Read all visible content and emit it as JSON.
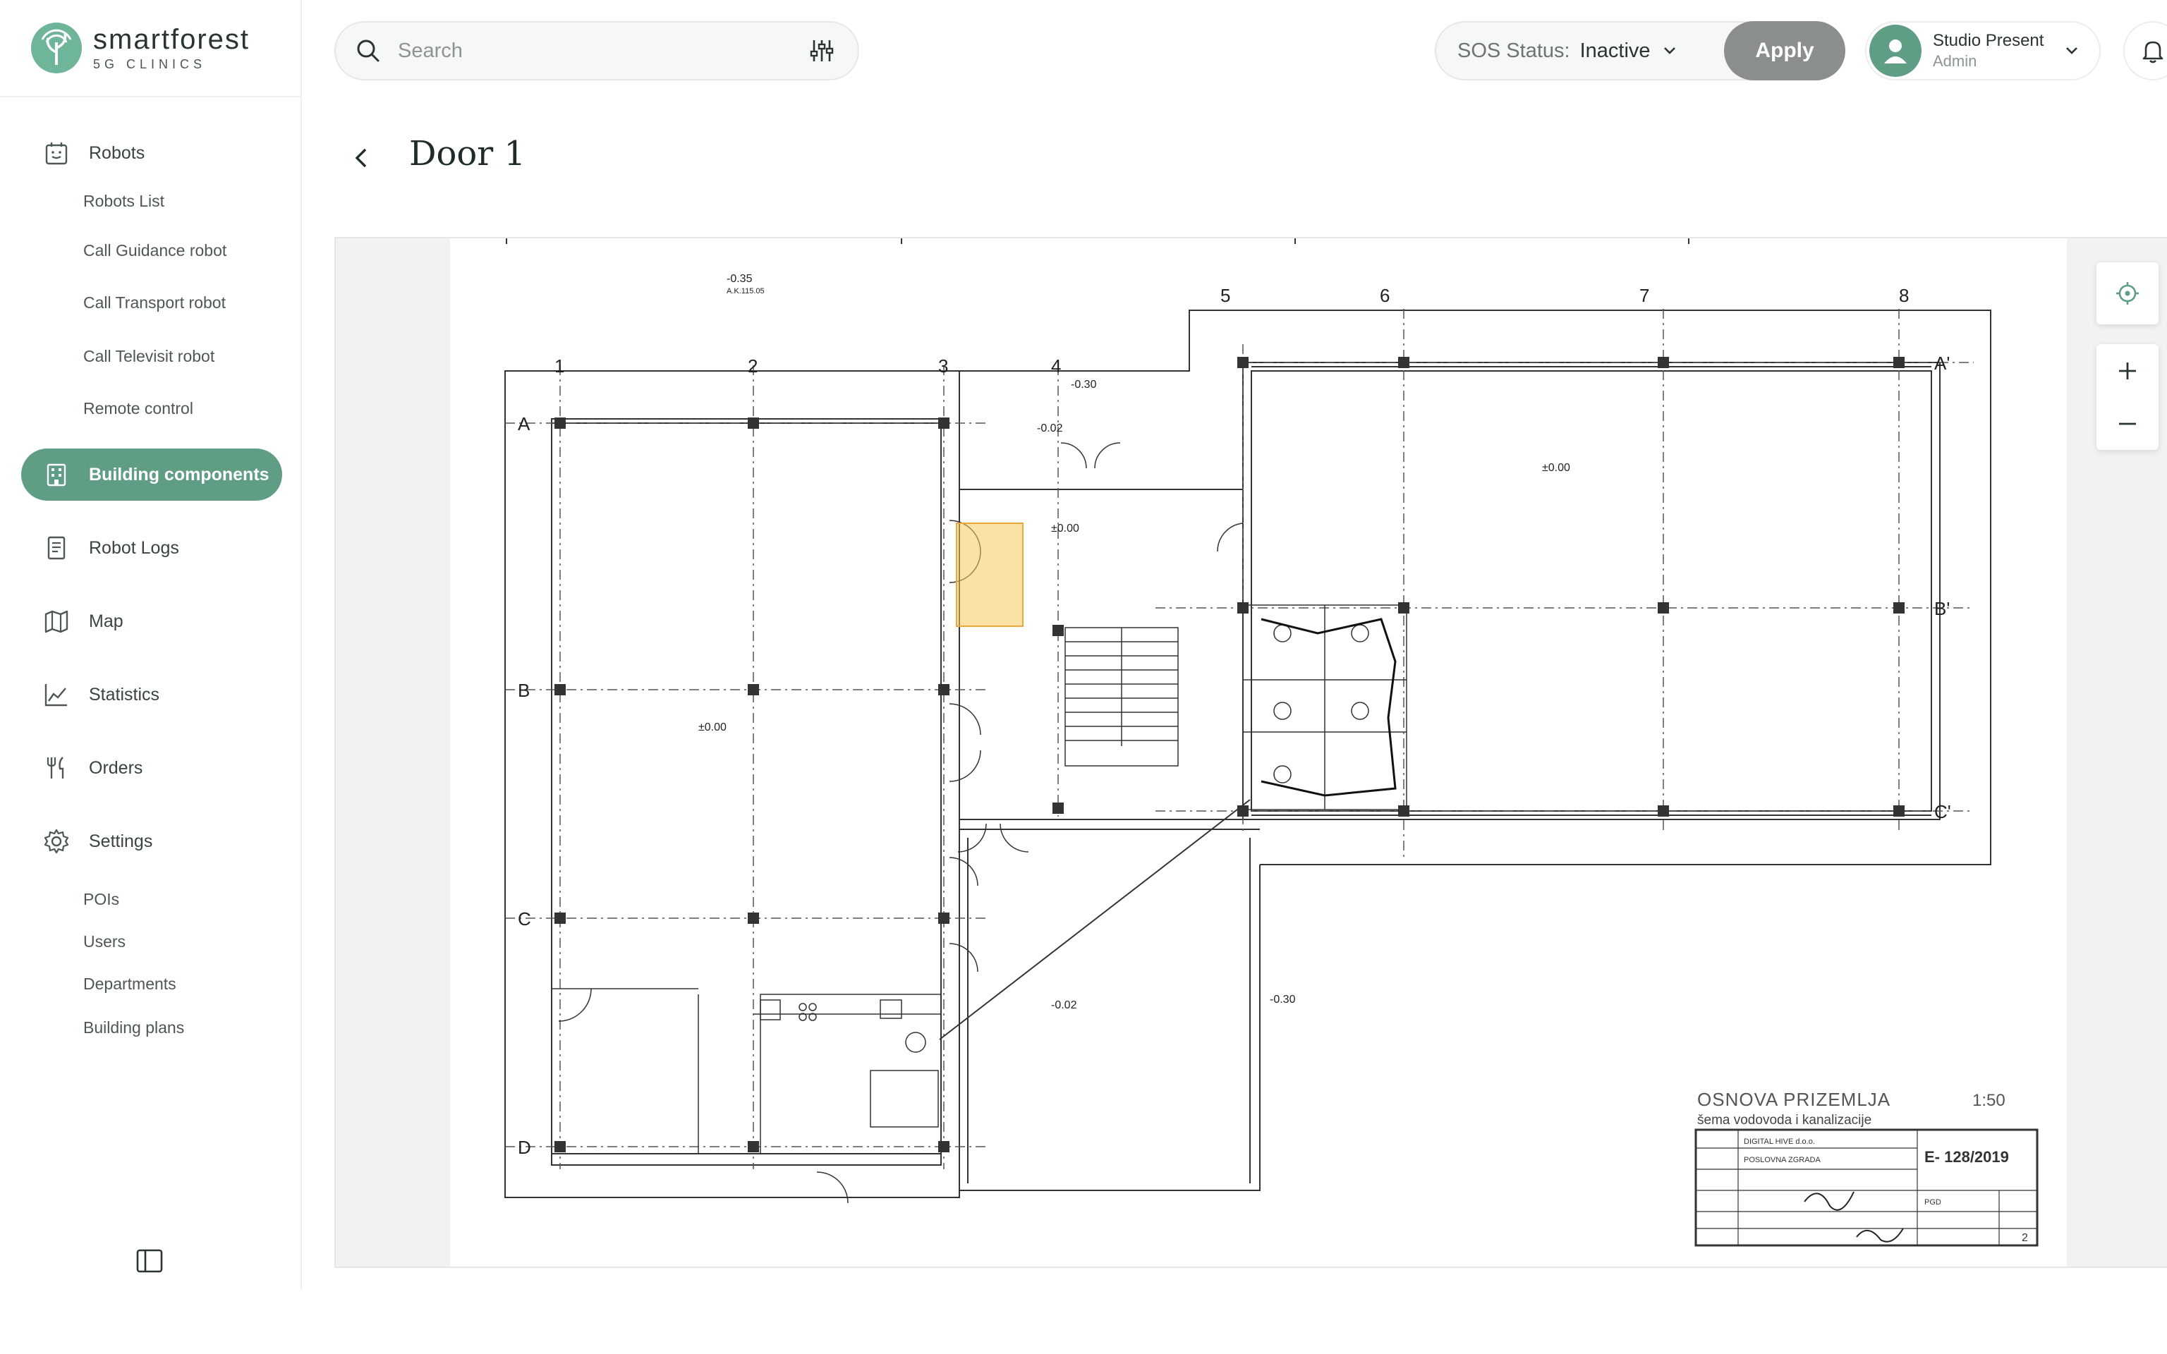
{
  "brand": {
    "name": "smartforest",
    "sub": "5G CLINICS"
  },
  "sidebar": {
    "robots": {
      "label": "Robots",
      "icon": "robot-icon",
      "items": [
        {
          "label": "Robots List"
        },
        {
          "label": "Call Guidance robot"
        },
        {
          "label": "Call Transport robot"
        },
        {
          "label": "Call Televisit robot"
        },
        {
          "label": "Remote control"
        }
      ]
    },
    "building": {
      "label": "Building components",
      "icon": "building-icon",
      "active": true
    },
    "logs": {
      "label": "Robot Logs",
      "icon": "document-icon"
    },
    "map": {
      "label": "Map",
      "icon": "map-icon"
    },
    "statistics": {
      "label": "Statistics",
      "icon": "chart-icon"
    },
    "orders": {
      "label": "Orders",
      "icon": "cutlery-icon"
    },
    "settings": {
      "label": "Settings",
      "icon": "gear-icon",
      "items": [
        {
          "label": "POIs"
        },
        {
          "label": "Users"
        },
        {
          "label": "Departments"
        },
        {
          "label": "Building plans"
        }
      ]
    }
  },
  "topbar": {
    "search": {
      "placeholder": "Search"
    },
    "sos": {
      "label": "SOS Status:",
      "value": "Inactive",
      "apply_label": "Apply"
    },
    "user": {
      "name": "Studio Present",
      "role": "Admin"
    }
  },
  "page": {
    "title": "Door 1"
  },
  "plan": {
    "axes_cols": [
      "1",
      "2",
      "3",
      "4",
      "5",
      "6",
      "7",
      "8"
    ],
    "axes_rows_left": [
      "A",
      "B",
      "C",
      "D"
    ],
    "axes_rows_right": [
      "A'",
      "B'",
      "C'"
    ],
    "levels": [
      "-0.35",
      "A.K.115.05",
      "-0.30",
      "-0.02",
      "±0.00",
      "±0.00",
      "±0.00",
      "-0.02",
      "-0.30"
    ],
    "title_block": {
      "heading": "OSNOVA PRIZEMLJA",
      "scale": "1:50",
      "subheading": "šema vodovoda i kanalizacije",
      "drawing_no": "E- 128/2019",
      "investor": "DIGITAL HIVE d.o.o.",
      "object": "POSLOVNA ZGRADA",
      "phase": "PGD",
      "sheet": "2"
    },
    "highlight_color": "#f7c95a"
  }
}
